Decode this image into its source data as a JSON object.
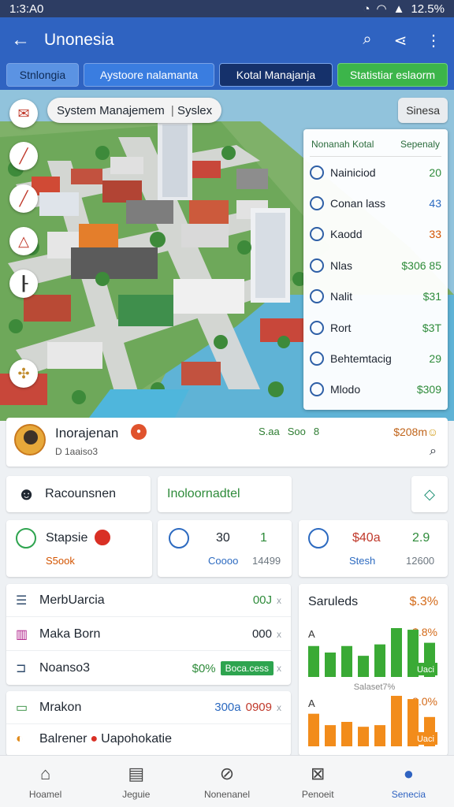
{
  "status": {
    "time": "1:3:A0",
    "battery": "12.5%"
  },
  "appbar": {
    "title": "Unonesia"
  },
  "tabs": [
    "Stnlongia",
    "Aystoore nalamanta",
    "Kotal Manajanja",
    "Statistiar eslaorm"
  ],
  "map": {
    "chip_title": "System Manajemem",
    "chip_sub": "Syslex",
    "control": "Sinesa",
    "tool_icons": [
      "envelope-icon",
      "edit-icon",
      "edit-icon",
      "warning-icon",
      "flag-icon",
      "download-icon"
    ],
    "panel": {
      "header_left": "Nonanah Kotal",
      "header_right": "Sepenaly",
      "rows": [
        {
          "label": "Nainiciod",
          "value": "20",
          "color": "#2e8b3a"
        },
        {
          "label": "Conan lass",
          "value": "43",
          "color": "#2c6ac0"
        },
        {
          "label": "Kaodd",
          "value": "33",
          "color": "#d35400"
        },
        {
          "label": "Nlas",
          "value": "$306 85",
          "color": "#2e8b3a"
        },
        {
          "label": "Nalit",
          "value": "$31",
          "color": "#2e8b3a"
        },
        {
          "label": "Rort",
          "value": "$3T",
          "color": "#2e8b3a"
        },
        {
          "label": "Behtemtacig",
          "value": "29",
          "color": "#2e8b3a"
        },
        {
          "label": "Mlodo",
          "value": "$309",
          "color": "#2e8b3a"
        }
      ]
    }
  },
  "profile": {
    "name": "Inorajenan",
    "sub": "D  1aaiso3",
    "stats": [
      "S.aa",
      "Soo",
      "8"
    ],
    "amount": "$208m"
  },
  "quick": {
    "left": "Racounsnen",
    "middle": "Inoloornadtel"
  },
  "metrics": [
    {
      "title": "Stapsie",
      "sub": "S5ook",
      "colors": {
        "ring": "#2ea44f",
        "sub": "#d35400"
      }
    },
    {
      "title": "30",
      "value": "1",
      "sub": "Coooo",
      "sub2": "14499"
    },
    {
      "title": "$40a",
      "value": "2.9",
      "sub": "Stesh",
      "sub2": "12600"
    }
  ],
  "list1": [
    {
      "label": "MerbUarcia",
      "value": "00J",
      "x": "x",
      "color": "#2e8b3a"
    },
    {
      "label": "Maka Born",
      "value": "000",
      "x": "x",
      "color": "#222"
    },
    {
      "label": "Noanso3",
      "value": "$0%",
      "pill": "Boca.cess",
      "x": "x",
      "color": "#2e8b3a"
    }
  ],
  "list2": [
    {
      "label": "Mrakon",
      "value": "300a",
      "value2": "0909",
      "x": "x"
    },
    {
      "label": "Balrener",
      "extra": "Uapohokatie"
    }
  ],
  "chart1": {
    "title": "Saruleds",
    "value": "$.3%",
    "label": "A",
    "pct": "$.8%",
    "bars": [
      38,
      30,
      38,
      26,
      40,
      60,
      58,
      42
    ],
    "tag": "Uaci",
    "color": "#3aaa35"
  },
  "chart2": {
    "label": "A",
    "pct": "3.0%",
    "caption": "Salaset7%",
    "bars": [
      40,
      26,
      30,
      24,
      26,
      62,
      58,
      36
    ],
    "tag": "Uaci",
    "color": "#f28c1b"
  },
  "bottomnav": [
    {
      "label": "Hoamel",
      "icon": "home-icon"
    },
    {
      "label": "Jeguie",
      "icon": "document-icon"
    },
    {
      "label": "Nonenanel",
      "icon": "compass-icon"
    },
    {
      "label": "Penoeit",
      "icon": "inbox-icon"
    },
    {
      "label": "Senecia",
      "icon": "profile-icon"
    }
  ]
}
